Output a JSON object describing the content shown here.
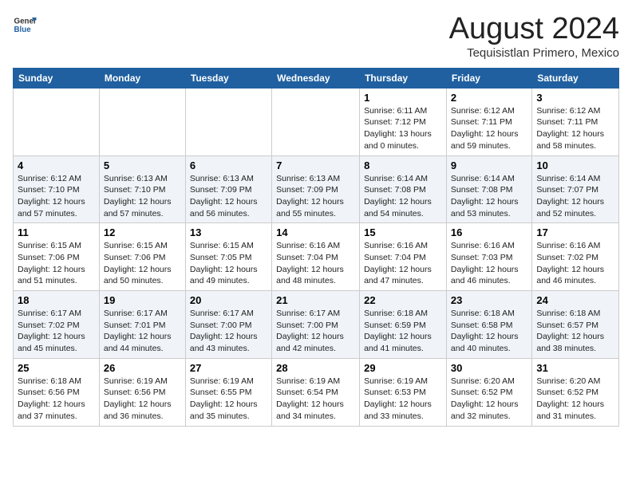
{
  "header": {
    "logo_general": "General",
    "logo_blue": "Blue",
    "month_title": "August 2024",
    "location": "Tequisistlan Primero, Mexico"
  },
  "weekdays": [
    "Sunday",
    "Monday",
    "Tuesday",
    "Wednesday",
    "Thursday",
    "Friday",
    "Saturday"
  ],
  "weeks": [
    [
      {
        "day": "",
        "info": ""
      },
      {
        "day": "",
        "info": ""
      },
      {
        "day": "",
        "info": ""
      },
      {
        "day": "",
        "info": ""
      },
      {
        "day": "1",
        "info": "Sunrise: 6:11 AM\nSunset: 7:12 PM\nDaylight: 13 hours\nand 0 minutes."
      },
      {
        "day": "2",
        "info": "Sunrise: 6:12 AM\nSunset: 7:11 PM\nDaylight: 12 hours\nand 59 minutes."
      },
      {
        "day": "3",
        "info": "Sunrise: 6:12 AM\nSunset: 7:11 PM\nDaylight: 12 hours\nand 58 minutes."
      }
    ],
    [
      {
        "day": "4",
        "info": "Sunrise: 6:12 AM\nSunset: 7:10 PM\nDaylight: 12 hours\nand 57 minutes."
      },
      {
        "day": "5",
        "info": "Sunrise: 6:13 AM\nSunset: 7:10 PM\nDaylight: 12 hours\nand 57 minutes."
      },
      {
        "day": "6",
        "info": "Sunrise: 6:13 AM\nSunset: 7:09 PM\nDaylight: 12 hours\nand 56 minutes."
      },
      {
        "day": "7",
        "info": "Sunrise: 6:13 AM\nSunset: 7:09 PM\nDaylight: 12 hours\nand 55 minutes."
      },
      {
        "day": "8",
        "info": "Sunrise: 6:14 AM\nSunset: 7:08 PM\nDaylight: 12 hours\nand 54 minutes."
      },
      {
        "day": "9",
        "info": "Sunrise: 6:14 AM\nSunset: 7:08 PM\nDaylight: 12 hours\nand 53 minutes."
      },
      {
        "day": "10",
        "info": "Sunrise: 6:14 AM\nSunset: 7:07 PM\nDaylight: 12 hours\nand 52 minutes."
      }
    ],
    [
      {
        "day": "11",
        "info": "Sunrise: 6:15 AM\nSunset: 7:06 PM\nDaylight: 12 hours\nand 51 minutes."
      },
      {
        "day": "12",
        "info": "Sunrise: 6:15 AM\nSunset: 7:06 PM\nDaylight: 12 hours\nand 50 minutes."
      },
      {
        "day": "13",
        "info": "Sunrise: 6:15 AM\nSunset: 7:05 PM\nDaylight: 12 hours\nand 49 minutes."
      },
      {
        "day": "14",
        "info": "Sunrise: 6:16 AM\nSunset: 7:04 PM\nDaylight: 12 hours\nand 48 minutes."
      },
      {
        "day": "15",
        "info": "Sunrise: 6:16 AM\nSunset: 7:04 PM\nDaylight: 12 hours\nand 47 minutes."
      },
      {
        "day": "16",
        "info": "Sunrise: 6:16 AM\nSunset: 7:03 PM\nDaylight: 12 hours\nand 46 minutes."
      },
      {
        "day": "17",
        "info": "Sunrise: 6:16 AM\nSunset: 7:02 PM\nDaylight: 12 hours\nand 46 minutes."
      }
    ],
    [
      {
        "day": "18",
        "info": "Sunrise: 6:17 AM\nSunset: 7:02 PM\nDaylight: 12 hours\nand 45 minutes."
      },
      {
        "day": "19",
        "info": "Sunrise: 6:17 AM\nSunset: 7:01 PM\nDaylight: 12 hours\nand 44 minutes."
      },
      {
        "day": "20",
        "info": "Sunrise: 6:17 AM\nSunset: 7:00 PM\nDaylight: 12 hours\nand 43 minutes."
      },
      {
        "day": "21",
        "info": "Sunrise: 6:17 AM\nSunset: 7:00 PM\nDaylight: 12 hours\nand 42 minutes."
      },
      {
        "day": "22",
        "info": "Sunrise: 6:18 AM\nSunset: 6:59 PM\nDaylight: 12 hours\nand 41 minutes."
      },
      {
        "day": "23",
        "info": "Sunrise: 6:18 AM\nSunset: 6:58 PM\nDaylight: 12 hours\nand 40 minutes."
      },
      {
        "day": "24",
        "info": "Sunrise: 6:18 AM\nSunset: 6:57 PM\nDaylight: 12 hours\nand 38 minutes."
      }
    ],
    [
      {
        "day": "25",
        "info": "Sunrise: 6:18 AM\nSunset: 6:56 PM\nDaylight: 12 hours\nand 37 minutes."
      },
      {
        "day": "26",
        "info": "Sunrise: 6:19 AM\nSunset: 6:56 PM\nDaylight: 12 hours\nand 36 minutes."
      },
      {
        "day": "27",
        "info": "Sunrise: 6:19 AM\nSunset: 6:55 PM\nDaylight: 12 hours\nand 35 minutes."
      },
      {
        "day": "28",
        "info": "Sunrise: 6:19 AM\nSunset: 6:54 PM\nDaylight: 12 hours\nand 34 minutes."
      },
      {
        "day": "29",
        "info": "Sunrise: 6:19 AM\nSunset: 6:53 PM\nDaylight: 12 hours\nand 33 minutes."
      },
      {
        "day": "30",
        "info": "Sunrise: 6:20 AM\nSunset: 6:52 PM\nDaylight: 12 hours\nand 32 minutes."
      },
      {
        "day": "31",
        "info": "Sunrise: 6:20 AM\nSunset: 6:52 PM\nDaylight: 12 hours\nand 31 minutes."
      }
    ]
  ]
}
